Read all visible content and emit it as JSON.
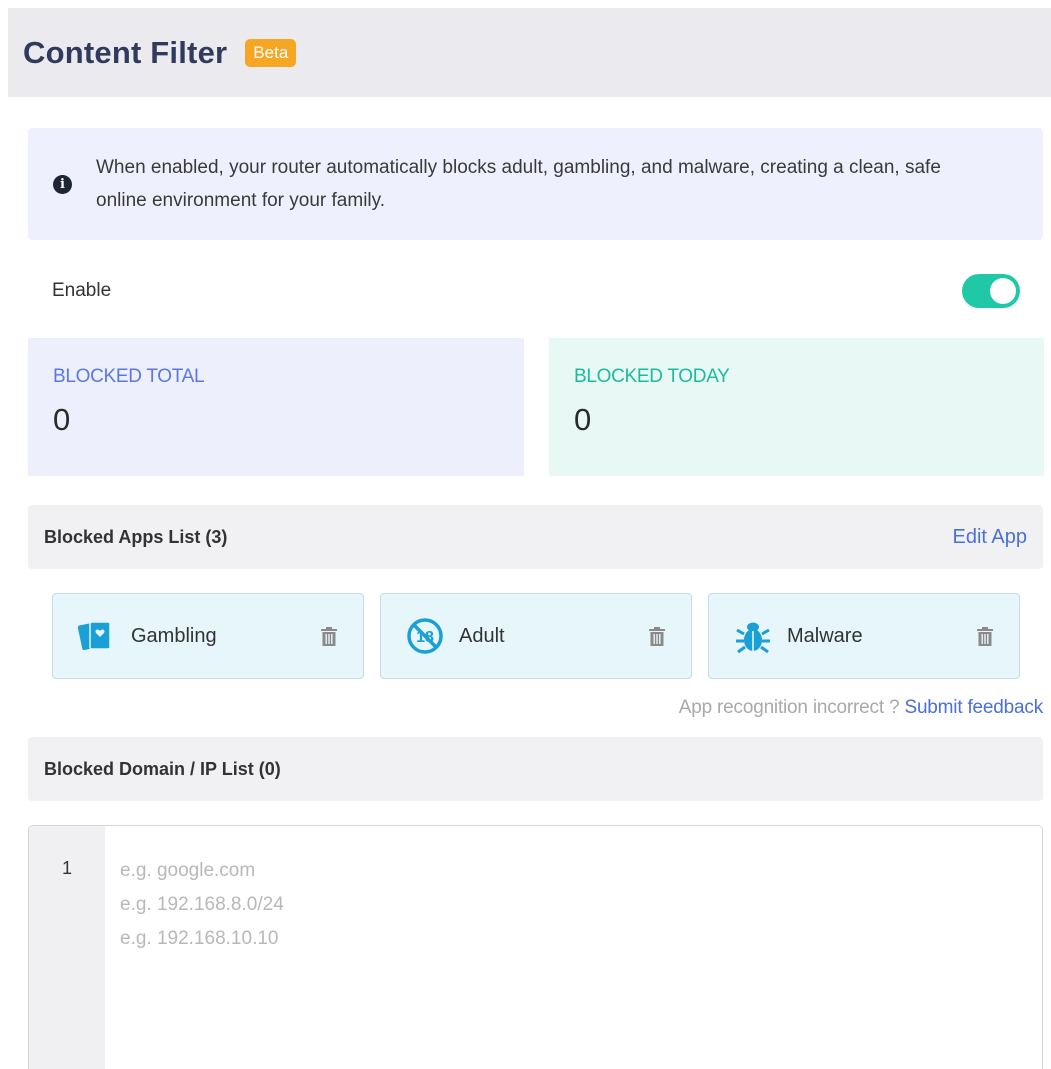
{
  "header": {
    "title": "Content Filter",
    "badge": "Beta"
  },
  "info": {
    "icon": "info-icon",
    "text": "When enabled, your router automatically blocks adult, gambling, and malware, creating a clean, safe online environment for your family."
  },
  "enable": {
    "label": "Enable",
    "enabled": true,
    "toggle_color": "#1fc8a7"
  },
  "stats": {
    "total": {
      "label": "BLOCKED TOTAL",
      "value": "0",
      "label_color": "#5a78e0"
    },
    "today": {
      "label": "BLOCKED TODAY",
      "value": "0",
      "label_color": "#1cbb9e"
    }
  },
  "apps_section": {
    "title": "Blocked Apps List (3)",
    "edit_label": "Edit App"
  },
  "apps": [
    {
      "label": "Gambling",
      "icon": "gambling-cards-icon"
    },
    {
      "label": "Adult",
      "icon": "no-18-icon"
    },
    {
      "label": "Malware",
      "icon": "bug-icon"
    }
  ],
  "feedback": {
    "question": "App recognition incorrect ?",
    "link": "Submit feedback"
  },
  "domain_section": {
    "title": "Blocked Domain / IP List (0)"
  },
  "editor": {
    "line_number": "1",
    "placeholder": "e.g. google.com\ne.g. 192.168.8.0/24\ne.g. 192.168.10.10"
  },
  "colors": {
    "accent": "#4a6fd8",
    "app_icon": "#1a9fd6",
    "badge": "#f5a623"
  }
}
